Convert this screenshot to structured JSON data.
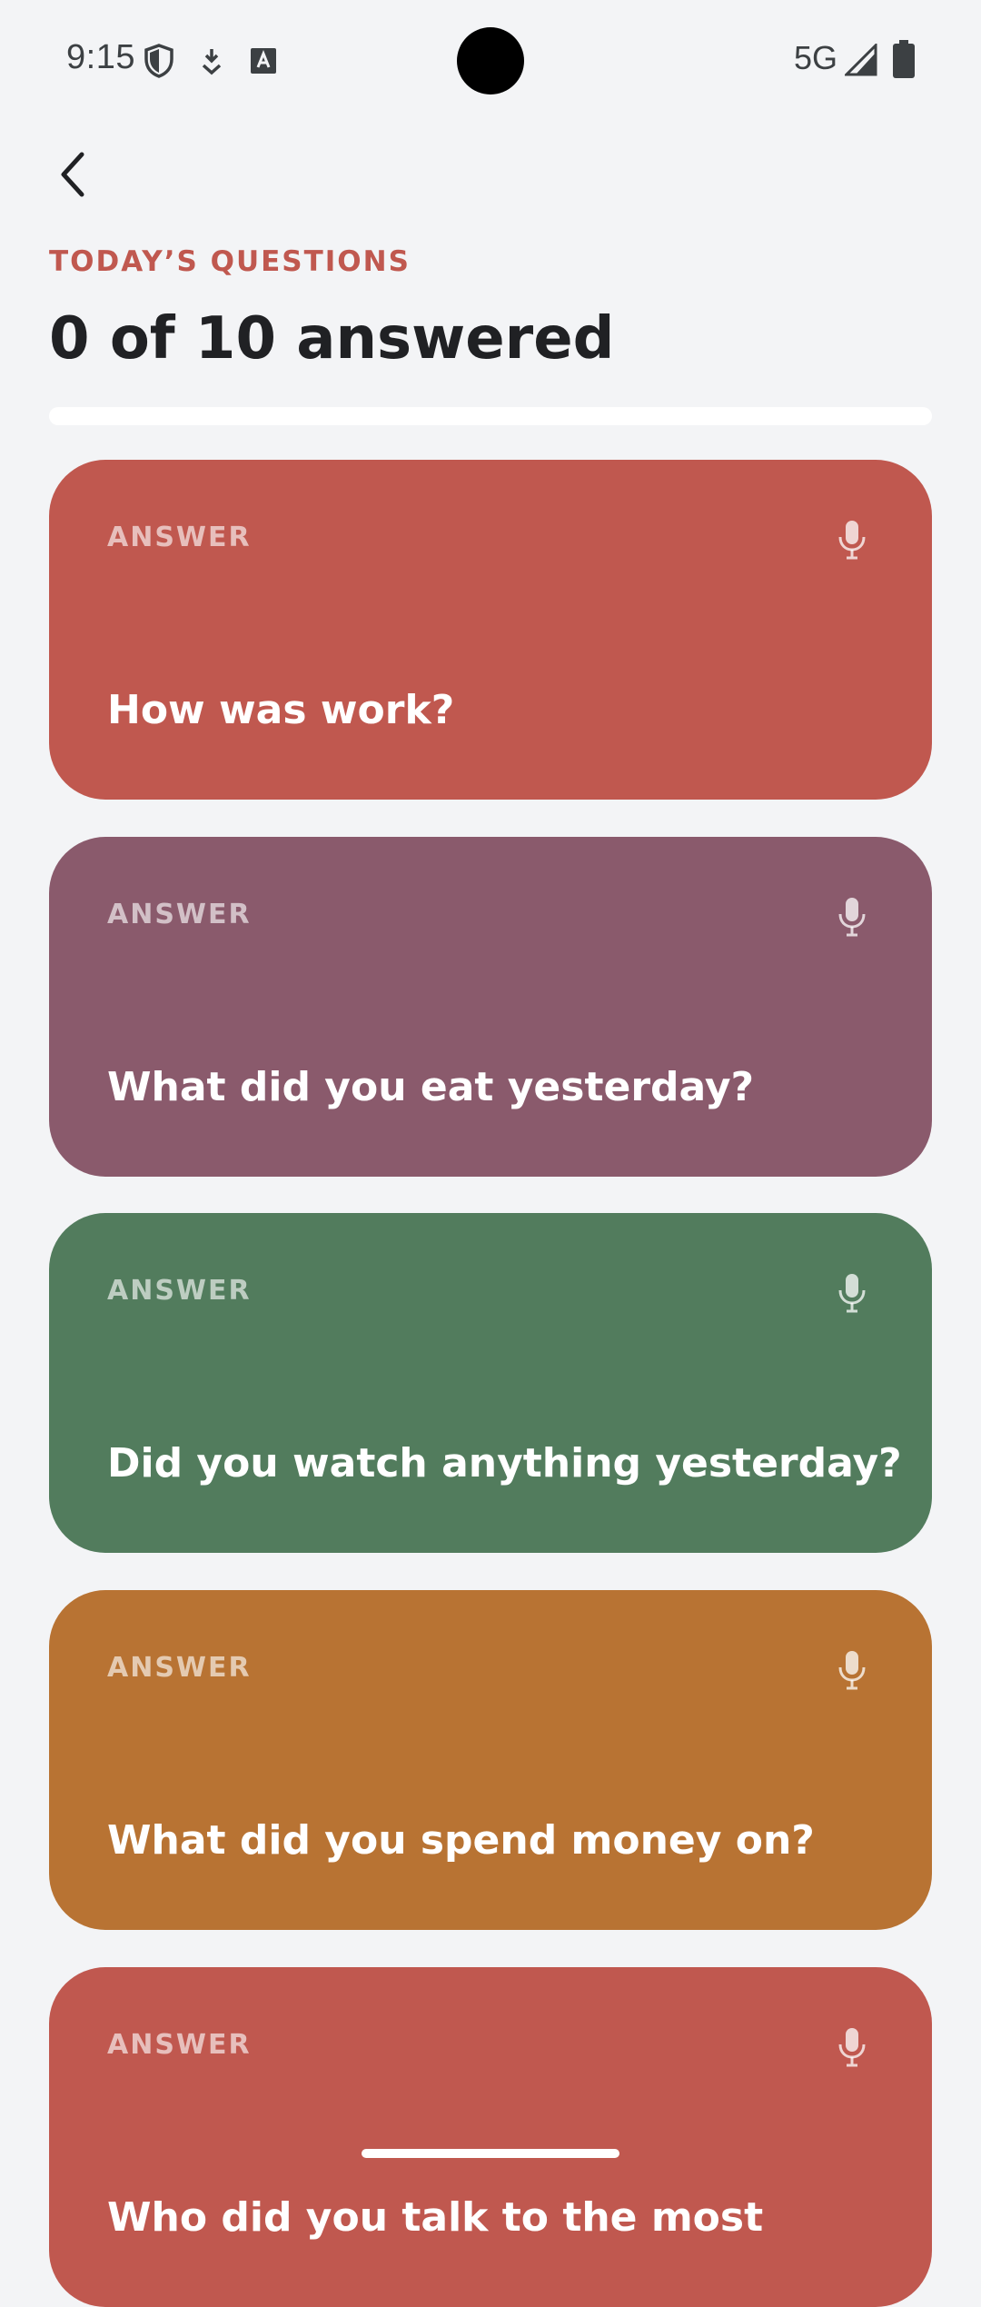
{
  "status_bar": {
    "time": "9:15",
    "network": "5G",
    "icons": [
      "shield-icon",
      "download-icon",
      "text-a-icon",
      "signal-icon",
      "battery-icon"
    ]
  },
  "header": {
    "back_icon": "chevron-left-icon",
    "eyebrow": "TODAY’S QUESTIONS",
    "progress_text": "0 of 10 answered",
    "answered": 0,
    "total": 10
  },
  "colors": {
    "background": "#f3f4f6",
    "accent": "#c0584f",
    "card_red": "#c0584f",
    "card_purple": "#8a5a6c",
    "card_green": "#527c5d",
    "card_orange": "#b87333"
  },
  "cards": [
    {
      "label": "ANSWER",
      "question": "How was work?",
      "color": "#c0584f",
      "icon": "microphone-icon"
    },
    {
      "label": "ANSWER",
      "question": "What did you eat yesterday?",
      "color": "#8a5a6c",
      "icon": "microphone-icon"
    },
    {
      "label": "ANSWER",
      "question": "Did you watch anything yesterday?",
      "color": "#527c5d",
      "icon": "microphone-icon"
    },
    {
      "label": "ANSWER",
      "question": "What did you spend money on?",
      "color": "#b87333",
      "icon": "microphone-icon"
    },
    {
      "label": "ANSWER",
      "question": "Who did you talk to the most",
      "color": "#c0584f",
      "icon": "microphone-icon"
    }
  ]
}
